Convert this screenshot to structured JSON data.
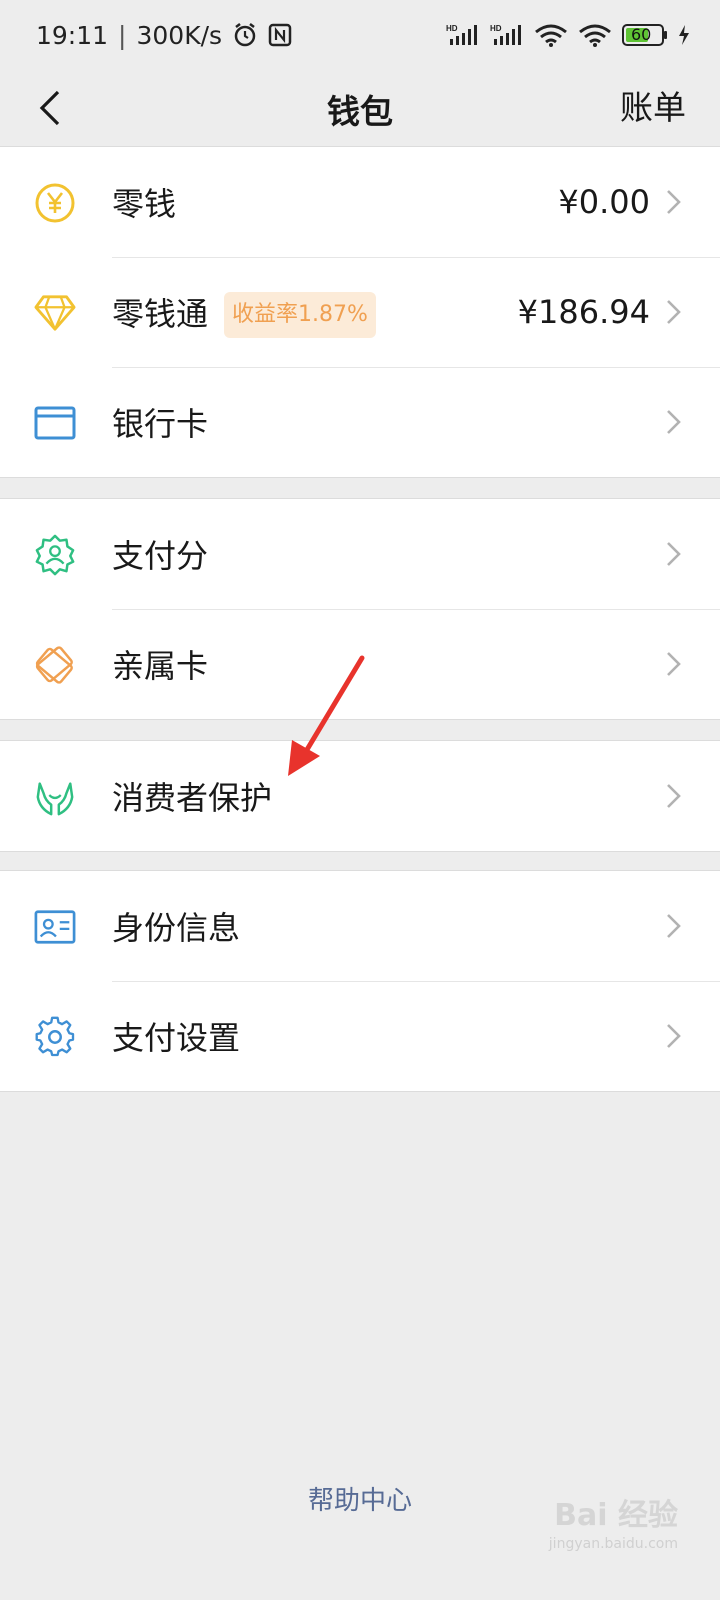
{
  "status_bar": {
    "time": "19:11",
    "net_speed": "300K/s",
    "battery": "60",
    "icons": [
      "alarm-icon",
      "nfc-icon",
      "signal-hd-icon",
      "signal-hd-icon",
      "wifi-icon",
      "wifi-link-icon",
      "battery-icon",
      "charging-icon"
    ]
  },
  "nav": {
    "title": "钱包",
    "action": "账单",
    "back_icon": "chevron-left-icon"
  },
  "groups": [
    {
      "items": [
        {
          "label": "零钱",
          "value": "¥0.00",
          "icon": "yuan-coin-icon",
          "color": "#f2c230"
        },
        {
          "label": "零钱通",
          "badge": "收益率1.87%",
          "value": "¥186.94",
          "icon": "diamond-icon",
          "color": "#f2c230"
        },
        {
          "label": "银行卡",
          "value": "",
          "icon": "bank-card-icon",
          "color": "#3e8fd4"
        }
      ]
    },
    {
      "items": [
        {
          "label": "支付分",
          "icon": "pay-score-icon",
          "color": "#2fbf82"
        },
        {
          "label": "亲属卡",
          "icon": "family-card-icon",
          "color": "#f0a051"
        }
      ]
    },
    {
      "items": [
        {
          "label": "消费者保护",
          "icon": "hands-protect-icon",
          "color": "#2fbf82"
        }
      ]
    },
    {
      "items": [
        {
          "label": "身份信息",
          "icon": "id-card-icon",
          "color": "#3e8fd4"
        },
        {
          "label": "支付设置",
          "icon": "gear-icon",
          "color": "#3e8fd4"
        }
      ]
    }
  ],
  "footer": {
    "help": "帮助中心"
  },
  "watermark": {
    "text": "Bai 经验",
    "sub": "jingyan.baidu.com"
  },
  "colors": {
    "background": "#ededed",
    "card": "#ffffff",
    "link": "#576b95",
    "badge_bg": "#fcebd8",
    "badge_text": "#f0a051",
    "annotation_arrow": "#e8332c"
  }
}
